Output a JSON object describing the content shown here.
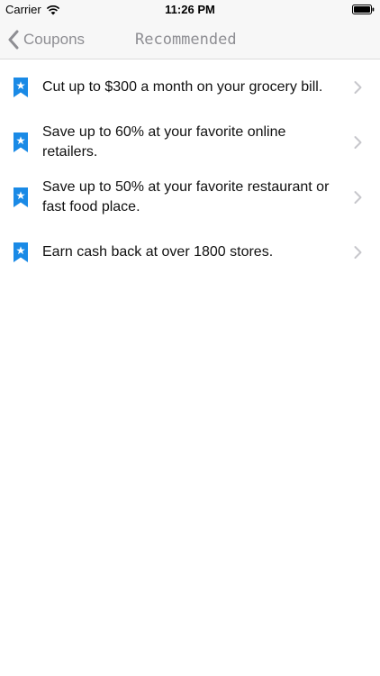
{
  "status_bar": {
    "carrier": "Carrier",
    "time": "11:26 PM",
    "icons": [
      "wifi-icon",
      "battery-icon"
    ]
  },
  "nav": {
    "back_label": "Coupons",
    "title": "Recommended",
    "back_icon": "chevron-left-icon"
  },
  "colors": {
    "accent_blue": "#1a8ae6",
    "nav_gray": "#8e8e93",
    "chevron_gray": "#c7c7cc",
    "bar_background": "#f7f7f7"
  },
  "list": {
    "items": [
      {
        "label": "Cut up to $300 a month on your grocery bill.",
        "icon": "bookmark-star-icon"
      },
      {
        "label": "Save up to 60% at your favorite online retailers.",
        "icon": "bookmark-star-icon"
      },
      {
        "label": "Save up to 50% at your favorite restaurant or fast food place.",
        "icon": "bookmark-star-icon"
      },
      {
        "label": "Earn cash back at over 1800 stores.",
        "icon": "bookmark-star-icon"
      }
    ]
  }
}
